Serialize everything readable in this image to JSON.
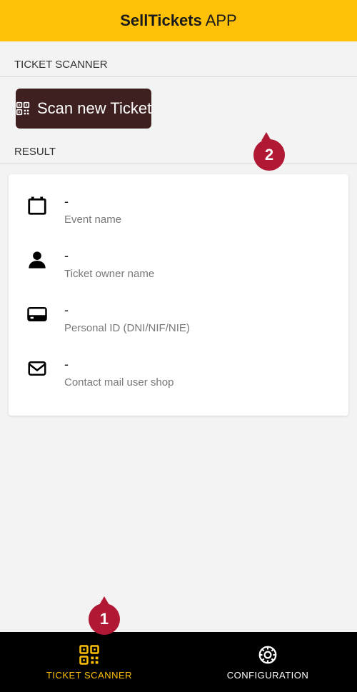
{
  "header": {
    "title_bold": "SellTickets",
    "title_light": " APP"
  },
  "sections": {
    "scanner": "TICKET SCANNER",
    "result": "RESULT"
  },
  "scan_button": {
    "label": "Scan new Ticket"
  },
  "result": {
    "event": {
      "value": "-",
      "label": "Event name"
    },
    "owner": {
      "value": "-",
      "label": "Ticket owner name"
    },
    "id": {
      "value": "-",
      "label": "Personal ID (DNI/NIF/NIE)"
    },
    "email": {
      "value": "-",
      "label": "Contact mail user shop"
    }
  },
  "nav": {
    "scanner": "TICKET SCANNER",
    "config": "CONFIGURATION"
  },
  "callouts": {
    "c1": "1",
    "c2": "2"
  },
  "colors": {
    "accent": "#ffc107",
    "scan_btn": "#3e2020",
    "callout": "#b01833"
  }
}
